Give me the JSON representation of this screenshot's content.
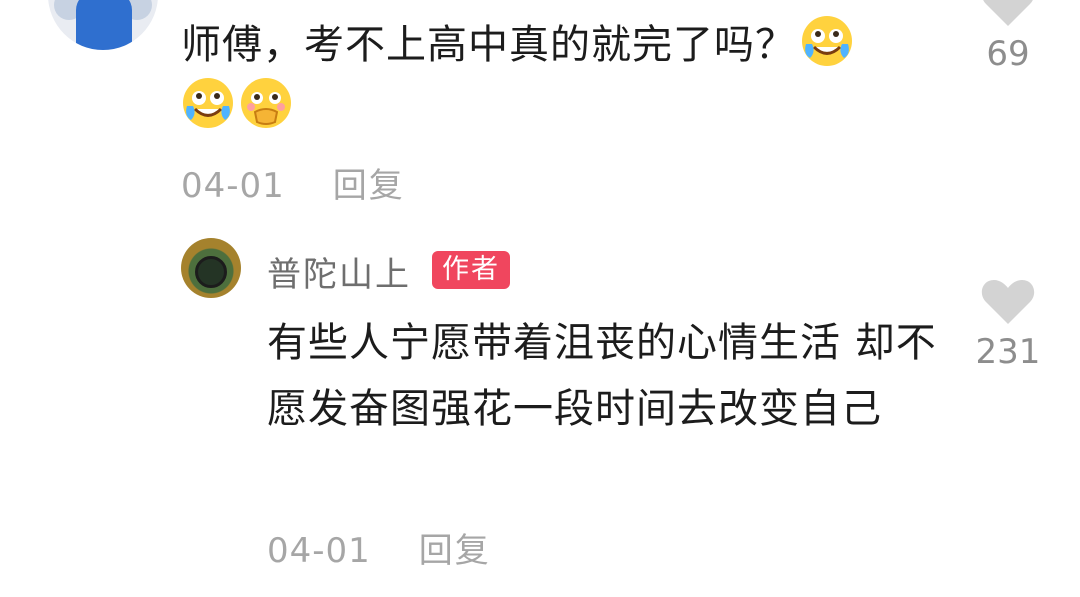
{
  "top_comment": {
    "text": "师傅，考不上高中真的就完了吗？",
    "emoji_1": "crying-laughing-emoji",
    "emoji_2": "crying-laughing-emoji",
    "emoji_3": "shy-covering-mouth-emoji",
    "date": "04-01",
    "reply_label": "回复",
    "like_count": "69"
  },
  "reply_comment": {
    "author_name": "普陀山上",
    "author_badge": "作者",
    "text": "有些人宁愿带着沮丧的心情生活 却不愿发奋图强花一段时间去改变自己",
    "date": "04-01",
    "reply_label": "回复",
    "like_count": "231"
  },
  "colors": {
    "like_icon": "#d3d3d3",
    "meta_text": "#a6a6a6",
    "badge_bg": "#f0465e"
  }
}
